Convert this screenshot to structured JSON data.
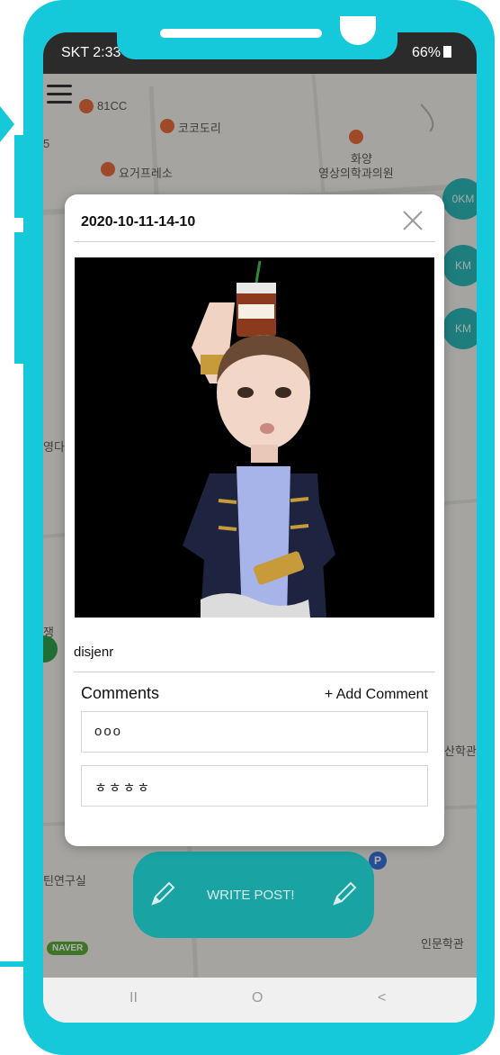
{
  "status_bar": {
    "carrier_time": "SKT 2:33",
    "battery": "66%"
  },
  "map": {
    "labels": [
      "81CC",
      "코코도리",
      "요거프레소",
      "화양",
      "영상의학과의원",
      "영다",
      "쟁",
      "산학관",
      "틴연구실",
      "인문학관",
      "5"
    ],
    "naver_badge": "NAVER",
    "km_buttons": [
      "0KM",
      "KM",
      "KM"
    ]
  },
  "modal": {
    "title": "2020-10-11-14-10",
    "author": "disjenr",
    "comments_title": "Comments",
    "add_comment_label": "+ Add Comment",
    "comments": [
      "ooo",
      "ㅎㅎㅎㅎ"
    ]
  },
  "write_post": {
    "label": "WRITE POST!"
  },
  "nav_bar": {
    "recents": "II",
    "home": "O",
    "back": "<"
  },
  "colors": {
    "frame": "#16c9da",
    "accent": "#1aa3a3"
  }
}
